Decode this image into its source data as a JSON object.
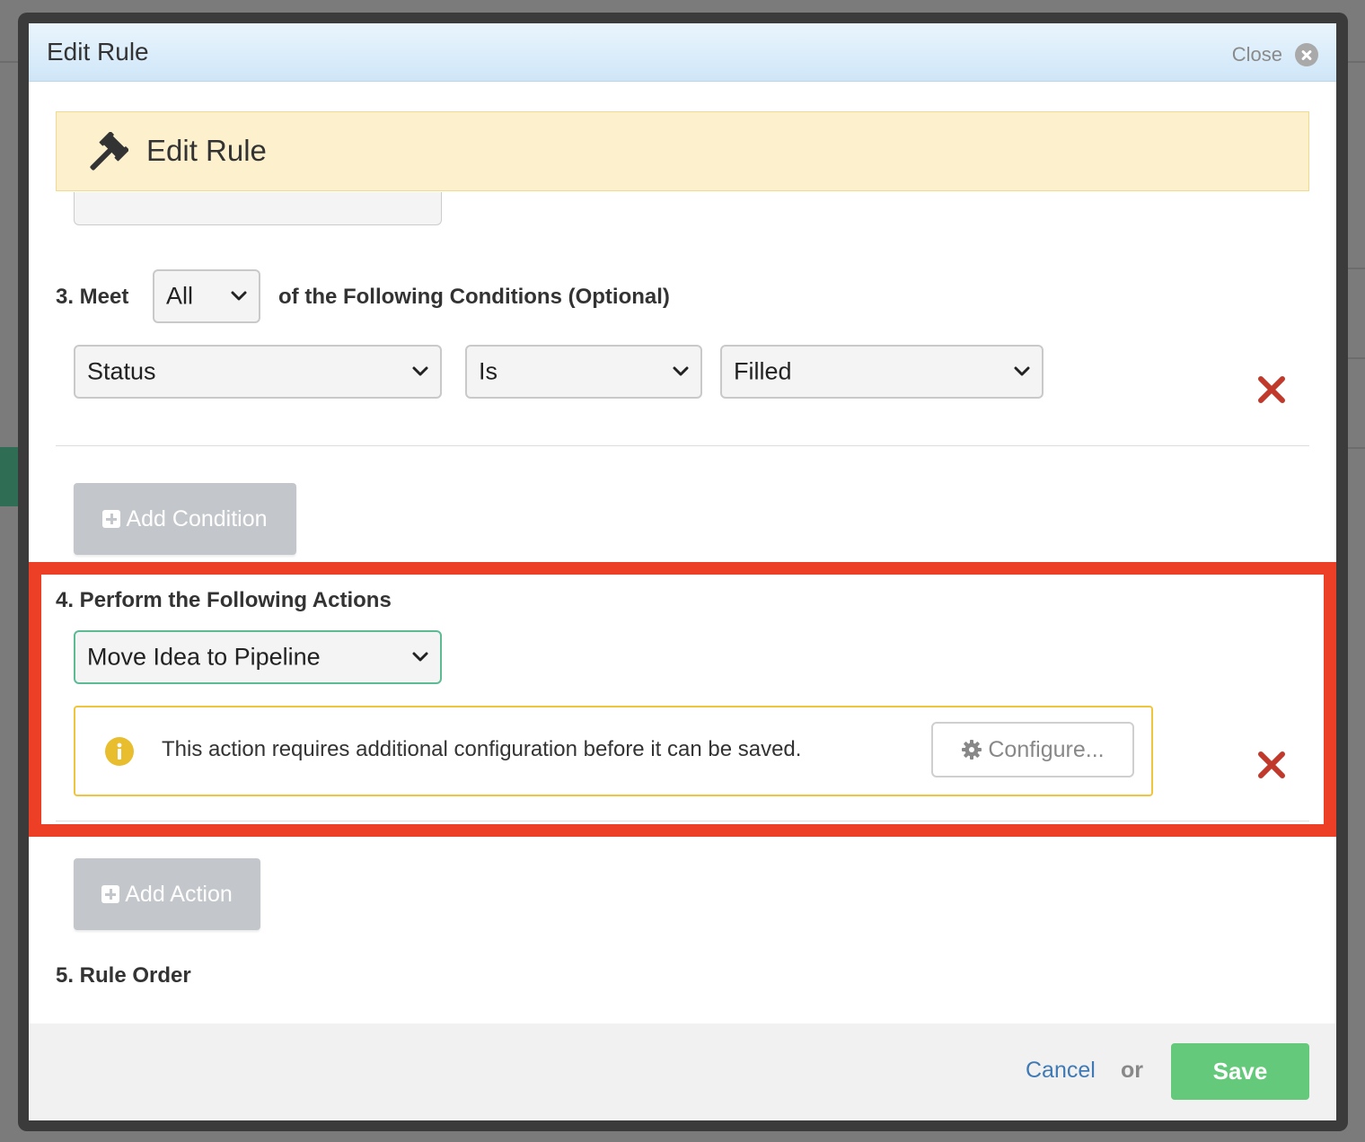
{
  "dialog": {
    "title": "Edit Rule",
    "close_label": "Close"
  },
  "banner": {
    "title": "Edit Rule",
    "icon": "gavel-icon"
  },
  "conditions": {
    "label_prefix": "3. Meet",
    "match_value": "All",
    "label_suffix": "of the Following Conditions (Optional)",
    "rows": [
      {
        "field": "Status",
        "operator": "Is",
        "value": "Filled"
      }
    ],
    "add_button_label": "Add Condition"
  },
  "actions": {
    "label": "4. Perform the Following Actions",
    "selected_action": "Move Idea to Pipeline",
    "notice_text": "This action requires additional configuration before it can be saved.",
    "configure_label": "Configure...",
    "add_button_label": "Add Action"
  },
  "rule_order": {
    "label": "5. Rule Order"
  },
  "footer": {
    "cancel_label": "Cancel",
    "or_text": "or",
    "save_label": "Save"
  },
  "colors": {
    "highlight": "#ec3f25",
    "remove": "#c0392b",
    "save": "#64c97a",
    "banner": "#fdf0cd",
    "notice_border": "#f0c53e"
  }
}
